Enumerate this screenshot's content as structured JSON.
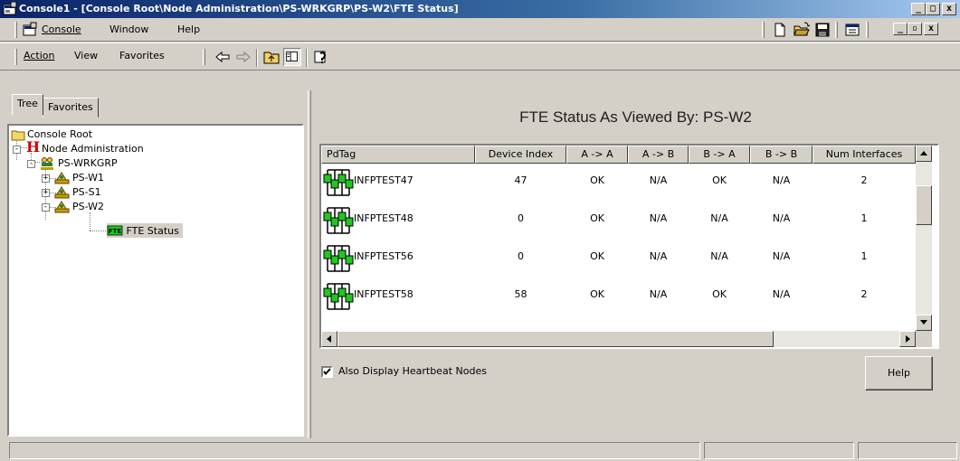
{
  "window": {
    "title": "Console1 - [Console Root\\Node Administration\\PS-WRKGRP\\PS-W2\\FTE Status]",
    "controls": {
      "minimize": "_",
      "maximize": "□",
      "close": "x"
    }
  },
  "menubar": {
    "items": [
      {
        "label": "Console",
        "accel": "C"
      },
      {
        "label": "Window",
        "accel": "W"
      },
      {
        "label": "Help",
        "accel": "H"
      }
    ],
    "toolbar_icons": [
      "new-document-icon",
      "open-folder-icon",
      "save-icon",
      "properties-icon"
    ],
    "child_controls": {
      "minimize": "_",
      "restore": "▫",
      "close": "x"
    }
  },
  "actionbar": {
    "items": [
      {
        "label": "Action",
        "accel": "A"
      },
      {
        "label": "View",
        "accel": "V"
      },
      {
        "label": "Favorites",
        "accel": "F"
      }
    ],
    "toolbar_icons": [
      "back-arrow-icon",
      "forward-arrow-icon",
      "up-one-level-icon",
      "show-hide-tree-icon",
      "help-topics-icon"
    ]
  },
  "left_pane": {
    "tabs": [
      {
        "label": "Tree",
        "active": true
      },
      {
        "label": "Favorites",
        "active": false
      }
    ],
    "tree": [
      {
        "label": "Console Root",
        "icon": "folder-icon",
        "level": 0
      },
      {
        "label": "Node Administration",
        "icon": "honeywell-h-icon",
        "level": 1,
        "expander": "-"
      },
      {
        "label": "PS-WRKGRP",
        "icon": "workgroup-icon",
        "level": 2,
        "expander": "-"
      },
      {
        "label": "PS-W1",
        "icon": "node-icon",
        "level": 3,
        "expander": "+"
      },
      {
        "label": "PS-S1",
        "icon": "node-icon",
        "level": 3,
        "expander": "+"
      },
      {
        "label": "PS-W2",
        "icon": "node-icon",
        "level": 3,
        "expander": "-"
      },
      {
        "label": "FTE Status",
        "icon": "fte-status-icon",
        "level": 4,
        "selected": true
      }
    ]
  },
  "right_pane": {
    "title": "FTE Status As Viewed By: PS-W2",
    "columns": [
      "PdTag",
      "Device Index",
      "A -> A",
      "A -> B",
      "B -> A",
      "B -> B",
      "Num Interfaces"
    ],
    "rows": [
      {
        "pdtag": "INFPTEST47",
        "device_index": "47",
        "aa": "OK",
        "ab": "N/A",
        "ba": "OK",
        "bb": "N/A",
        "num_interfaces": "2"
      },
      {
        "pdtag": "INFPTEST48",
        "device_index": "0",
        "aa": "OK",
        "ab": "N/A",
        "ba": "N/A",
        "bb": "N/A",
        "num_interfaces": "1"
      },
      {
        "pdtag": "INFPTEST56",
        "device_index": "0",
        "aa": "OK",
        "ab": "N/A",
        "ba": "N/A",
        "bb": "N/A",
        "num_interfaces": "1"
      },
      {
        "pdtag": "INFPTEST58",
        "device_index": "58",
        "aa": "OK",
        "ab": "N/A",
        "ba": "OK",
        "bb": "N/A",
        "num_interfaces": "2"
      }
    ],
    "row_icon": "fte-device-icon",
    "heartbeat_checkbox": {
      "label": "Also Display Heartbeat Nodes",
      "checked": true
    },
    "help_button": "Help"
  },
  "colors": {
    "title_bar_start": "#0a246a",
    "title_bar_end": "#a6caf0",
    "face": "#d4d0c8",
    "device_green": "#1ec81e",
    "honeywell_red": "#d00000"
  }
}
